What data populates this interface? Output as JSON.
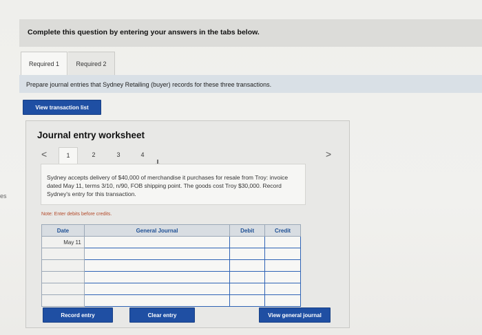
{
  "margin_text": "es",
  "instruction": "Complete this question by entering your answers in the tabs below.",
  "tabs": [
    {
      "label": "Required 1"
    },
    {
      "label": "Required 2"
    }
  ],
  "prompt": "Prepare journal entries that Sydney Retailing (buyer) records for these three transactions.",
  "view_transaction_list_label": "View transaction list",
  "worksheet": {
    "title": "Journal entry worksheet",
    "nav_prev": "<",
    "nav_next": ">",
    "steps": [
      "1",
      "2",
      "3",
      "4"
    ],
    "description": "Sydney accepts delivery of $40,000 of merchandise it purchases for resale from Troy: invoice dated May 11, terms 3/10, n/90, FOB shipping point. The goods cost Troy $30,000. Record Sydney's entry for this transaction.",
    "note": "Note: Enter debits before credits.",
    "table": {
      "headers": [
        "Date",
        "General Journal",
        "Debit",
        "Credit"
      ],
      "rows": [
        {
          "date": "May 11",
          "account": "",
          "debit": "",
          "credit": ""
        },
        {
          "date": "",
          "account": "",
          "debit": "",
          "credit": ""
        },
        {
          "date": "",
          "account": "",
          "debit": "",
          "credit": ""
        },
        {
          "date": "",
          "account": "",
          "debit": "",
          "credit": ""
        },
        {
          "date": "",
          "account": "",
          "debit": "",
          "credit": ""
        },
        {
          "date": "",
          "account": "",
          "debit": "",
          "credit": ""
        }
      ]
    },
    "buttons": {
      "record": "Record entry",
      "clear": "Clear entry",
      "view_general_journal": "View general journal"
    }
  },
  "colors": {
    "button_blue": "#1f4fa3",
    "header_text_blue": "#1d4f94",
    "note_red": "#b34a2a"
  }
}
